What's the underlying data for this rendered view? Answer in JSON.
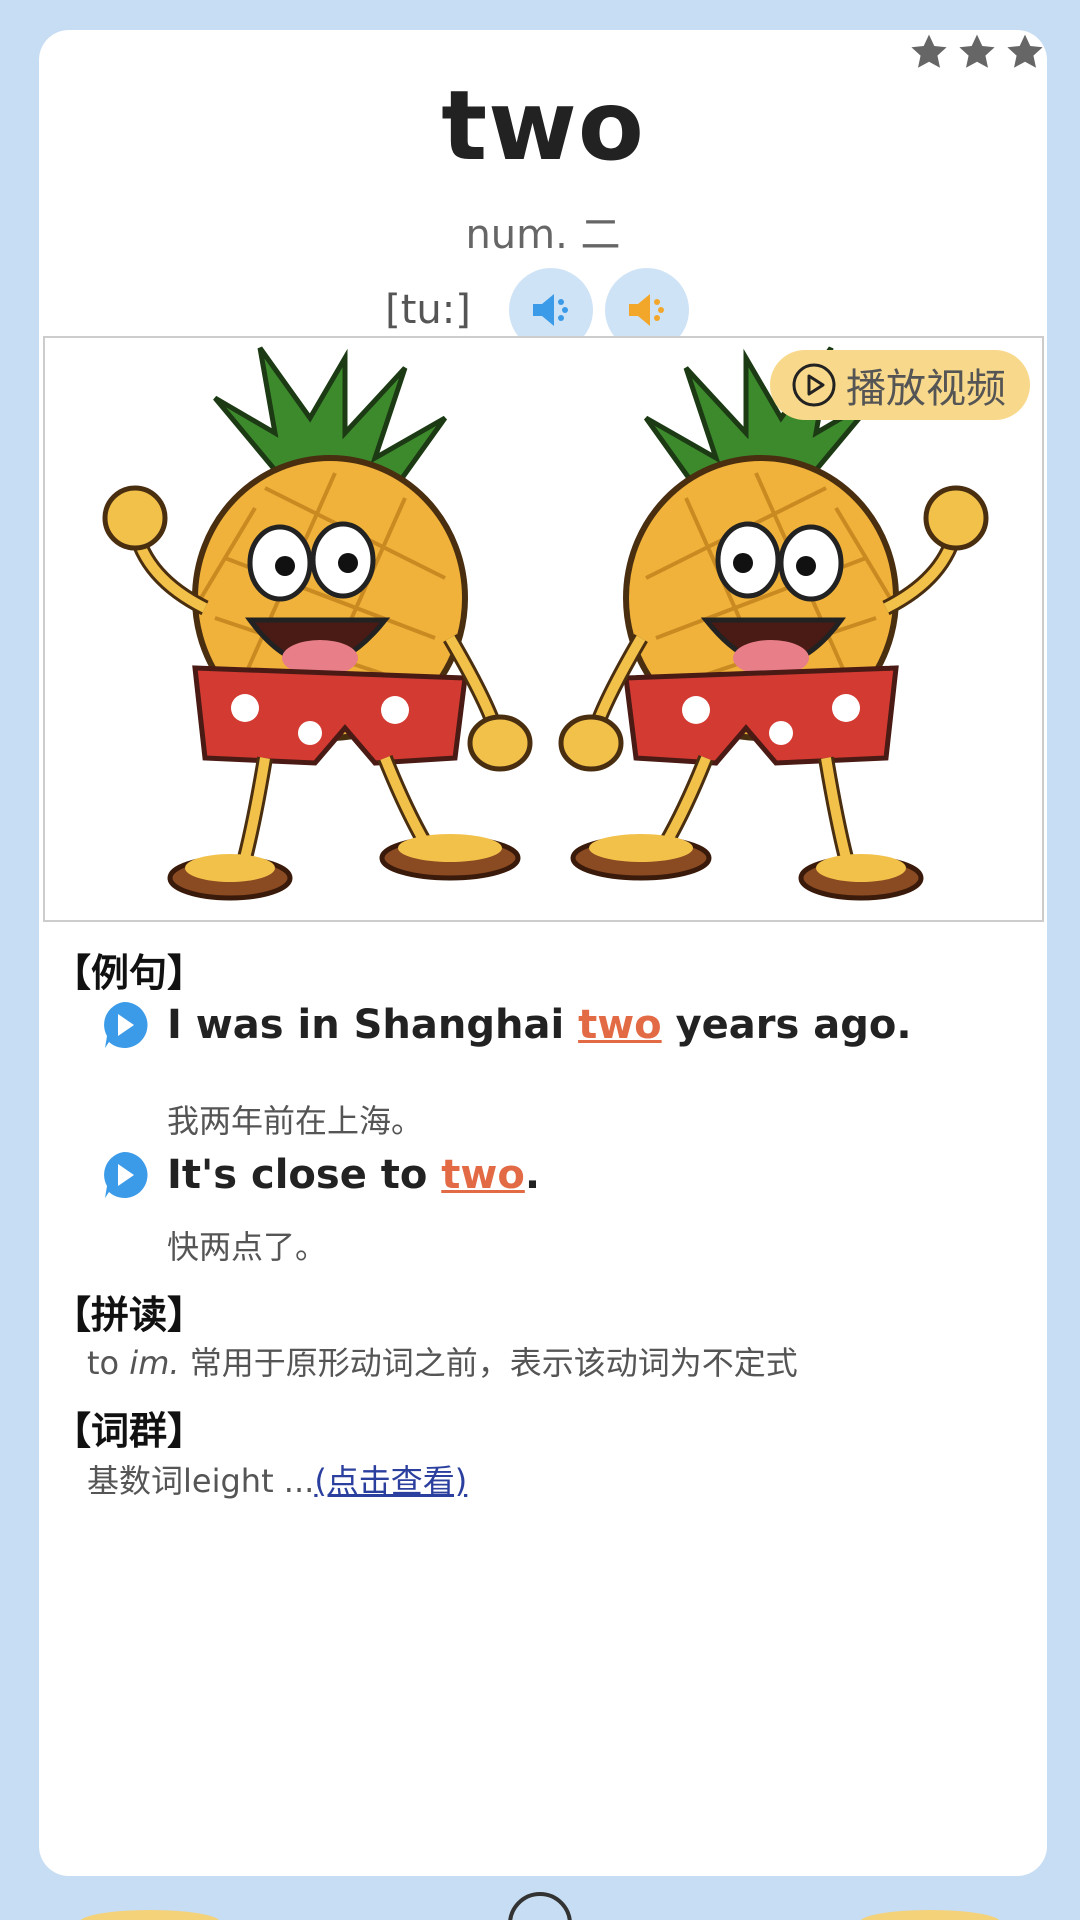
{
  "word": {
    "text": "two",
    "part_of_speech": "num. 二",
    "phonetic": "[tu:]",
    "star_rating": 3
  },
  "audio": {
    "uk_icon": "speaker-blue-icon",
    "us_icon": "speaker-yellow-icon"
  },
  "media": {
    "play_video_label": "播放视频",
    "image_description": "two cartoon pineapples"
  },
  "examples": {
    "heading": "【例句】",
    "items": [
      {
        "before": "I was in Shanghai ",
        "highlight": "two",
        "after": " years ago.",
        "translation": "我两年前在上海。"
      },
      {
        "before": "It's close to ",
        "highlight": "two",
        "after": ".",
        "translation": "快两点了。"
      }
    ]
  },
  "spelling": {
    "heading": "【拼读】",
    "word": "to",
    "abbr": "im.",
    "text": "常用于原形动词之前，表示该动词为不定式"
  },
  "word_group": {
    "heading": "【词群】",
    "text": "基数词leight ...",
    "link": "(点击查看)"
  },
  "colors": {
    "background": "#c7ddf3",
    "card": "#ffffff",
    "highlight": "#e26a45",
    "link": "#2b3f9e",
    "play_video_bg": "#f8d98b"
  }
}
